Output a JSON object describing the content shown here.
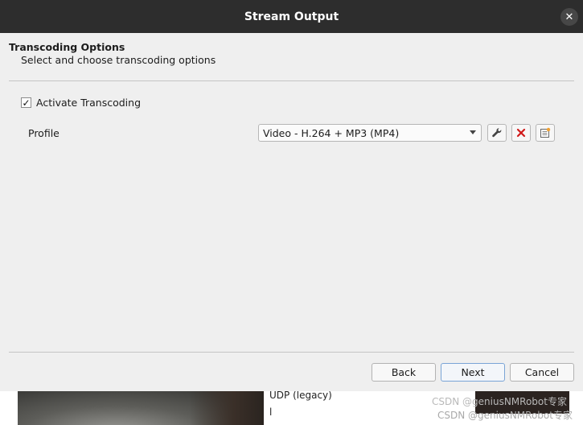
{
  "window": {
    "title": "Stream Output",
    "close_glyph": "✕"
  },
  "header": {
    "title": "Transcoding Options",
    "subtitle": "Select and choose transcoding options"
  },
  "transcoding": {
    "activate_label": "Activate Transcoding",
    "activate_checked": true,
    "check_glyph": "✓"
  },
  "profile": {
    "label": "Profile",
    "selected": "Video - H.264 + MP3 (MP4)",
    "icons": [
      "wrench-icon",
      "delete-icon",
      "new-profile-icon"
    ]
  },
  "buttons": {
    "back": "Back",
    "next": "Next",
    "cancel": "Cancel"
  },
  "background": {
    "list_item_1": "UDP (legacy)",
    "list_item_2": "l",
    "watermark_1": "CSDN @geniusNMRobot专家",
    "watermark_2": "CSDN @geniusNMRobot专家"
  },
  "colors": {
    "titlebar": "#2d2d2d",
    "dialog_bg": "#efefef",
    "delete_red": "#d11a1a",
    "default_button_border": "#7aa4d6"
  }
}
